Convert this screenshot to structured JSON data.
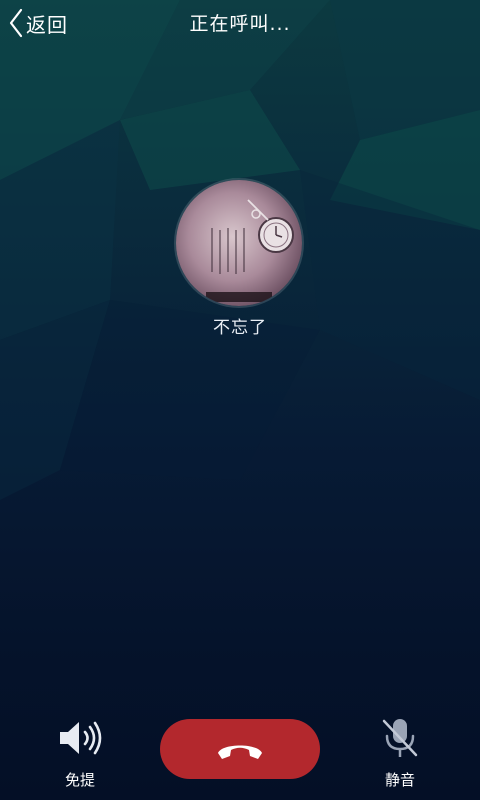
{
  "header": {
    "back_label": "返回",
    "title": "正在呼叫..."
  },
  "caller": {
    "name": "不忘了"
  },
  "controls": {
    "speaker_label": "免提",
    "mute_label": "静音"
  },
  "icons": {
    "back": "chevron-left-icon",
    "speaker": "speaker-icon",
    "hangup": "phone-hangup-icon",
    "mute": "microphone-off-icon"
  },
  "colors": {
    "hangup_button": "#b3282d",
    "text": "#ffffff"
  }
}
